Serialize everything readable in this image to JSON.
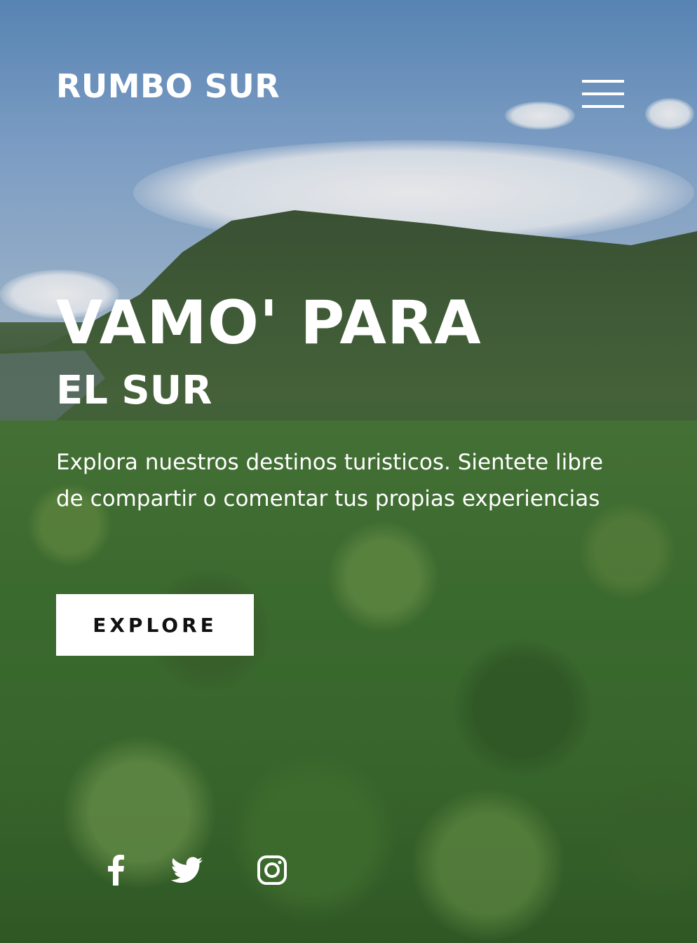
{
  "header": {
    "brand": "RUMBO SUR",
    "menu_icon": "hamburger-menu-icon"
  },
  "hero": {
    "headline": "VAMO' PARA",
    "subheadline": "EL SUR",
    "description": "Explora nuestros destinos turisticos. Sientete libre de compartir o comentar tus propias experiencias",
    "cta_label": "EXPLORE"
  },
  "social": {
    "icons": [
      "facebook-icon",
      "twitter-icon",
      "instagram-icon"
    ]
  },
  "colors": {
    "text": "#ffffff",
    "button_bg": "#ffffff",
    "button_text": "#111111"
  }
}
